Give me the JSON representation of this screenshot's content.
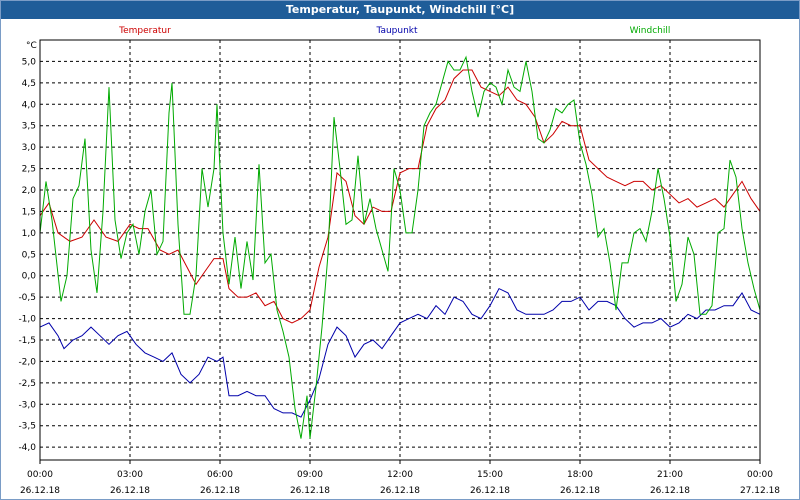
{
  "window": {
    "title": "Temperatur, Taupunkt, Windchill [°C]"
  },
  "chart_data": {
    "type": "line",
    "title": "Temperatur, Taupunkt, Windchill [°C]",
    "ylabel": "°C",
    "ylim": [
      -4.0,
      5.0
    ],
    "y_ticks": [
      "5,0",
      "4,5",
      "4,0",
      "3,5",
      "3,0",
      "2,5",
      "2,0",
      "1,5",
      "1,0",
      "0,5",
      "0,0",
      "-0,5",
      "-1,0",
      "-1,5",
      "-2,0",
      "-2,5",
      "-3,0",
      "-3,5",
      "-4,0"
    ],
    "x_ticks": [
      {
        "time": "00:00",
        "date": "26.12.18"
      },
      {
        "time": "03:00",
        "date": "26.12.18"
      },
      {
        "time": "06:00",
        "date": "26.12.18"
      },
      {
        "time": "09:00",
        "date": "26.12.18"
      },
      {
        "time": "12:00",
        "date": "26.12.18"
      },
      {
        "time": "15:00",
        "date": "26.12.18"
      },
      {
        "time": "18:00",
        "date": "26.12.18"
      },
      {
        "time": "21:00",
        "date": "26.12.18"
      },
      {
        "time": "00:00",
        "date": "27.12.18"
      }
    ],
    "xlim": [
      0,
      24
    ],
    "grid": true,
    "legend": "top",
    "series": [
      {
        "name": "Temperatur",
        "color": "#cc0000",
        "points": [
          [
            0,
            1.4
          ],
          [
            0.3,
            1.7
          ],
          [
            0.6,
            1.0
          ],
          [
            1.0,
            0.8
          ],
          [
            1.4,
            0.9
          ],
          [
            1.8,
            1.3
          ],
          [
            2.2,
            0.9
          ],
          [
            2.6,
            0.8
          ],
          [
            3.0,
            1.2
          ],
          [
            3.3,
            1.1
          ],
          [
            3.6,
            1.1
          ],
          [
            4.0,
            0.6
          ],
          [
            4.3,
            0.5
          ],
          [
            4.6,
            0.6
          ],
          [
            4.9,
            0.2
          ],
          [
            5.2,
            -0.2
          ],
          [
            5.5,
            0.1
          ],
          [
            5.8,
            0.4
          ],
          [
            6.1,
            0.4
          ],
          [
            6.3,
            -0.3
          ],
          [
            6.6,
            -0.5
          ],
          [
            6.9,
            -0.5
          ],
          [
            7.2,
            -0.4
          ],
          [
            7.5,
            -0.7
          ],
          [
            7.8,
            -0.6
          ],
          [
            8.1,
            -1.0
          ],
          [
            8.4,
            -1.1
          ],
          [
            8.7,
            -1.0
          ],
          [
            9.0,
            -0.8
          ],
          [
            9.3,
            0.2
          ],
          [
            9.6,
            0.9
          ],
          [
            9.9,
            2.4
          ],
          [
            10.2,
            2.2
          ],
          [
            10.5,
            1.4
          ],
          [
            10.8,
            1.2
          ],
          [
            11.1,
            1.6
          ],
          [
            11.4,
            1.5
          ],
          [
            11.7,
            1.5
          ],
          [
            12.0,
            2.4
          ],
          [
            12.3,
            2.5
          ],
          [
            12.6,
            2.5
          ],
          [
            12.9,
            3.5
          ],
          [
            13.2,
            3.9
          ],
          [
            13.5,
            4.1
          ],
          [
            13.8,
            4.6
          ],
          [
            14.1,
            4.8
          ],
          [
            14.4,
            4.8
          ],
          [
            14.7,
            4.4
          ],
          [
            15.0,
            4.3
          ],
          [
            15.3,
            4.2
          ],
          [
            15.6,
            4.4
          ],
          [
            15.9,
            4.1
          ],
          [
            16.2,
            4.0
          ],
          [
            16.5,
            3.7
          ],
          [
            16.8,
            3.1
          ],
          [
            17.1,
            3.3
          ],
          [
            17.4,
            3.6
          ],
          [
            17.7,
            3.5
          ],
          [
            18.0,
            3.5
          ],
          [
            18.3,
            2.7
          ],
          [
            18.6,
            2.5
          ],
          [
            18.9,
            2.3
          ],
          [
            19.2,
            2.2
          ],
          [
            19.5,
            2.1
          ],
          [
            19.8,
            2.2
          ],
          [
            20.1,
            2.2
          ],
          [
            20.4,
            2.0
          ],
          [
            20.7,
            2.1
          ],
          [
            21.0,
            1.9
          ],
          [
            21.3,
            1.7
          ],
          [
            21.6,
            1.8
          ],
          [
            21.9,
            1.6
          ],
          [
            22.2,
            1.7
          ],
          [
            22.5,
            1.8
          ],
          [
            22.8,
            1.6
          ],
          [
            23.1,
            1.9
          ],
          [
            23.4,
            2.2
          ],
          [
            23.7,
            1.8
          ],
          [
            24.0,
            1.5
          ]
        ]
      },
      {
        "name": "Taupunkt",
        "color": "#0000aa",
        "points": [
          [
            0,
            -1.2
          ],
          [
            0.3,
            -1.1
          ],
          [
            0.6,
            -1.4
          ],
          [
            0.8,
            -1.7
          ],
          [
            1.1,
            -1.5
          ],
          [
            1.4,
            -1.4
          ],
          [
            1.7,
            -1.2
          ],
          [
            2.0,
            -1.4
          ],
          [
            2.3,
            -1.6
          ],
          [
            2.6,
            -1.4
          ],
          [
            2.9,
            -1.3
          ],
          [
            3.2,
            -1.6
          ],
          [
            3.5,
            -1.8
          ],
          [
            3.8,
            -1.9
          ],
          [
            4.1,
            -2.0
          ],
          [
            4.4,
            -1.8
          ],
          [
            4.7,
            -2.3
          ],
          [
            5.0,
            -2.5
          ],
          [
            5.3,
            -2.3
          ],
          [
            5.6,
            -1.9
          ],
          [
            5.9,
            -2.0
          ],
          [
            6.1,
            -1.9
          ],
          [
            6.3,
            -2.8
          ],
          [
            6.6,
            -2.8
          ],
          [
            6.9,
            -2.7
          ],
          [
            7.2,
            -2.8
          ],
          [
            7.5,
            -2.8
          ],
          [
            7.8,
            -3.1
          ],
          [
            8.1,
            -3.2
          ],
          [
            8.4,
            -3.2
          ],
          [
            8.7,
            -3.3
          ],
          [
            9.0,
            -2.9
          ],
          [
            9.3,
            -2.4
          ],
          [
            9.6,
            -1.6
          ],
          [
            9.9,
            -1.2
          ],
          [
            10.2,
            -1.4
          ],
          [
            10.5,
            -1.9
          ],
          [
            10.8,
            -1.6
          ],
          [
            11.1,
            -1.5
          ],
          [
            11.4,
            -1.7
          ],
          [
            11.7,
            -1.4
          ],
          [
            12.0,
            -1.1
          ],
          [
            12.3,
            -1.0
          ],
          [
            12.6,
            -0.9
          ],
          [
            12.9,
            -1.0
          ],
          [
            13.2,
            -0.7
          ],
          [
            13.5,
            -0.9
          ],
          [
            13.8,
            -0.5
          ],
          [
            14.1,
            -0.6
          ],
          [
            14.4,
            -0.9
          ],
          [
            14.7,
            -1.0
          ],
          [
            15.0,
            -0.7
          ],
          [
            15.3,
            -0.3
          ],
          [
            15.6,
            -0.4
          ],
          [
            15.9,
            -0.8
          ],
          [
            16.2,
            -0.9
          ],
          [
            16.5,
            -0.9
          ],
          [
            16.8,
            -0.9
          ],
          [
            17.1,
            -0.8
          ],
          [
            17.4,
            -0.6
          ],
          [
            17.7,
            -0.6
          ],
          [
            18.0,
            -0.5
          ],
          [
            18.3,
            -0.8
          ],
          [
            18.6,
            -0.6
          ],
          [
            18.9,
            -0.6
          ],
          [
            19.2,
            -0.7
          ],
          [
            19.5,
            -1.0
          ],
          [
            19.8,
            -1.2
          ],
          [
            20.1,
            -1.1
          ],
          [
            20.4,
            -1.1
          ],
          [
            20.7,
            -1.0
          ],
          [
            21.0,
            -1.2
          ],
          [
            21.3,
            -1.1
          ],
          [
            21.6,
            -0.9
          ],
          [
            21.9,
            -1.0
          ],
          [
            22.2,
            -0.8
          ],
          [
            22.5,
            -0.8
          ],
          [
            22.8,
            -0.7
          ],
          [
            23.1,
            -0.7
          ],
          [
            23.4,
            -0.4
          ],
          [
            23.7,
            -0.8
          ],
          [
            24.0,
            -0.9
          ]
        ]
      },
      {
        "name": "Windchill",
        "color": "#00aa00",
        "points": [
          [
            0,
            1.0
          ],
          [
            0.2,
            2.2
          ],
          [
            0.4,
            1.3
          ],
          [
            0.7,
            -0.6
          ],
          [
            0.9,
            0.0
          ],
          [
            1.1,
            1.8
          ],
          [
            1.3,
            2.1
          ],
          [
            1.5,
            3.2
          ],
          [
            1.7,
            0.6
          ],
          [
            1.9,
            -0.4
          ],
          [
            2.1,
            1.5
          ],
          [
            2.3,
            4.4
          ],
          [
            2.5,
            1.3
          ],
          [
            2.7,
            0.4
          ],
          [
            2.9,
            1.0
          ],
          [
            3.1,
            1.2
          ],
          [
            3.3,
            0.5
          ],
          [
            3.5,
            1.5
          ],
          [
            3.7,
            2.0
          ],
          [
            3.9,
            0.5
          ],
          [
            4.1,
            0.8
          ],
          [
            4.3,
            3.8
          ],
          [
            4.4,
            4.5
          ],
          [
            4.6,
            1.2
          ],
          [
            4.8,
            -0.9
          ],
          [
            5.0,
            -0.9
          ],
          [
            5.2,
            0.0
          ],
          [
            5.4,
            2.5
          ],
          [
            5.6,
            1.6
          ],
          [
            5.8,
            2.5
          ],
          [
            5.9,
            4.0
          ],
          [
            6.1,
            1.0
          ],
          [
            6.3,
            -0.2
          ],
          [
            6.5,
            0.9
          ],
          [
            6.7,
            -0.3
          ],
          [
            6.9,
            0.8
          ],
          [
            7.1,
            -0.1
          ],
          [
            7.3,
            2.6
          ],
          [
            7.5,
            0.3
          ],
          [
            7.7,
            0.5
          ],
          [
            7.9,
            -0.8
          ],
          [
            8.1,
            -1.3
          ],
          [
            8.3,
            -1.9
          ],
          [
            8.5,
            -3.1
          ],
          [
            8.7,
            -3.8
          ],
          [
            8.9,
            -2.8
          ],
          [
            9.0,
            -3.8
          ],
          [
            9.2,
            -2.6
          ],
          [
            9.4,
            -1.2
          ],
          [
            9.6,
            0.5
          ],
          [
            9.8,
            3.7
          ],
          [
            10.0,
            2.5
          ],
          [
            10.2,
            1.2
          ],
          [
            10.4,
            1.3
          ],
          [
            10.6,
            2.8
          ],
          [
            10.8,
            1.2
          ],
          [
            11.0,
            1.8
          ],
          [
            11.2,
            1.1
          ],
          [
            11.4,
            0.6
          ],
          [
            11.6,
            0.1
          ],
          [
            11.8,
            2.5
          ],
          [
            12.0,
            2.0
          ],
          [
            12.2,
            1.0
          ],
          [
            12.4,
            1.0
          ],
          [
            12.6,
            2.0
          ],
          [
            12.8,
            3.5
          ],
          [
            13.0,
            3.8
          ],
          [
            13.2,
            4.0
          ],
          [
            13.4,
            4.5
          ],
          [
            13.6,
            5.0
          ],
          [
            13.8,
            4.8
          ],
          [
            14.0,
            4.8
          ],
          [
            14.2,
            5.1
          ],
          [
            14.4,
            4.3
          ],
          [
            14.6,
            3.7
          ],
          [
            14.8,
            4.3
          ],
          [
            15.0,
            4.5
          ],
          [
            15.2,
            4.4
          ],
          [
            15.4,
            4.0
          ],
          [
            15.6,
            4.8
          ],
          [
            15.8,
            4.4
          ],
          [
            16.0,
            4.3
          ],
          [
            16.2,
            5.0
          ],
          [
            16.4,
            4.3
          ],
          [
            16.6,
            3.2
          ],
          [
            16.8,
            3.1
          ],
          [
            17.0,
            3.4
          ],
          [
            17.2,
            3.9
          ],
          [
            17.4,
            3.8
          ],
          [
            17.6,
            4.0
          ],
          [
            17.8,
            4.1
          ],
          [
            18.0,
            3.1
          ],
          [
            18.2,
            2.6
          ],
          [
            18.4,
            1.9
          ],
          [
            18.6,
            0.9
          ],
          [
            18.8,
            1.1
          ],
          [
            19.0,
            0.3
          ],
          [
            19.2,
            -0.8
          ],
          [
            19.4,
            0.3
          ],
          [
            19.6,
            0.3
          ],
          [
            19.8,
            1.0
          ],
          [
            20.0,
            1.1
          ],
          [
            20.2,
            0.8
          ],
          [
            20.4,
            1.5
          ],
          [
            20.6,
            2.5
          ],
          [
            20.8,
            1.8
          ],
          [
            21.0,
            0.9
          ],
          [
            21.2,
            -0.6
          ],
          [
            21.4,
            -0.2
          ],
          [
            21.6,
            0.9
          ],
          [
            21.8,
            0.5
          ],
          [
            22.0,
            -0.9
          ],
          [
            22.2,
            -0.9
          ],
          [
            22.4,
            -0.7
          ],
          [
            22.6,
            1.0
          ],
          [
            22.8,
            1.1
          ],
          [
            23.0,
            2.7
          ],
          [
            23.2,
            2.3
          ],
          [
            23.4,
            1.1
          ],
          [
            23.6,
            0.3
          ],
          [
            23.8,
            -0.3
          ],
          [
            24.0,
            -0.8
          ]
        ]
      }
    ]
  }
}
